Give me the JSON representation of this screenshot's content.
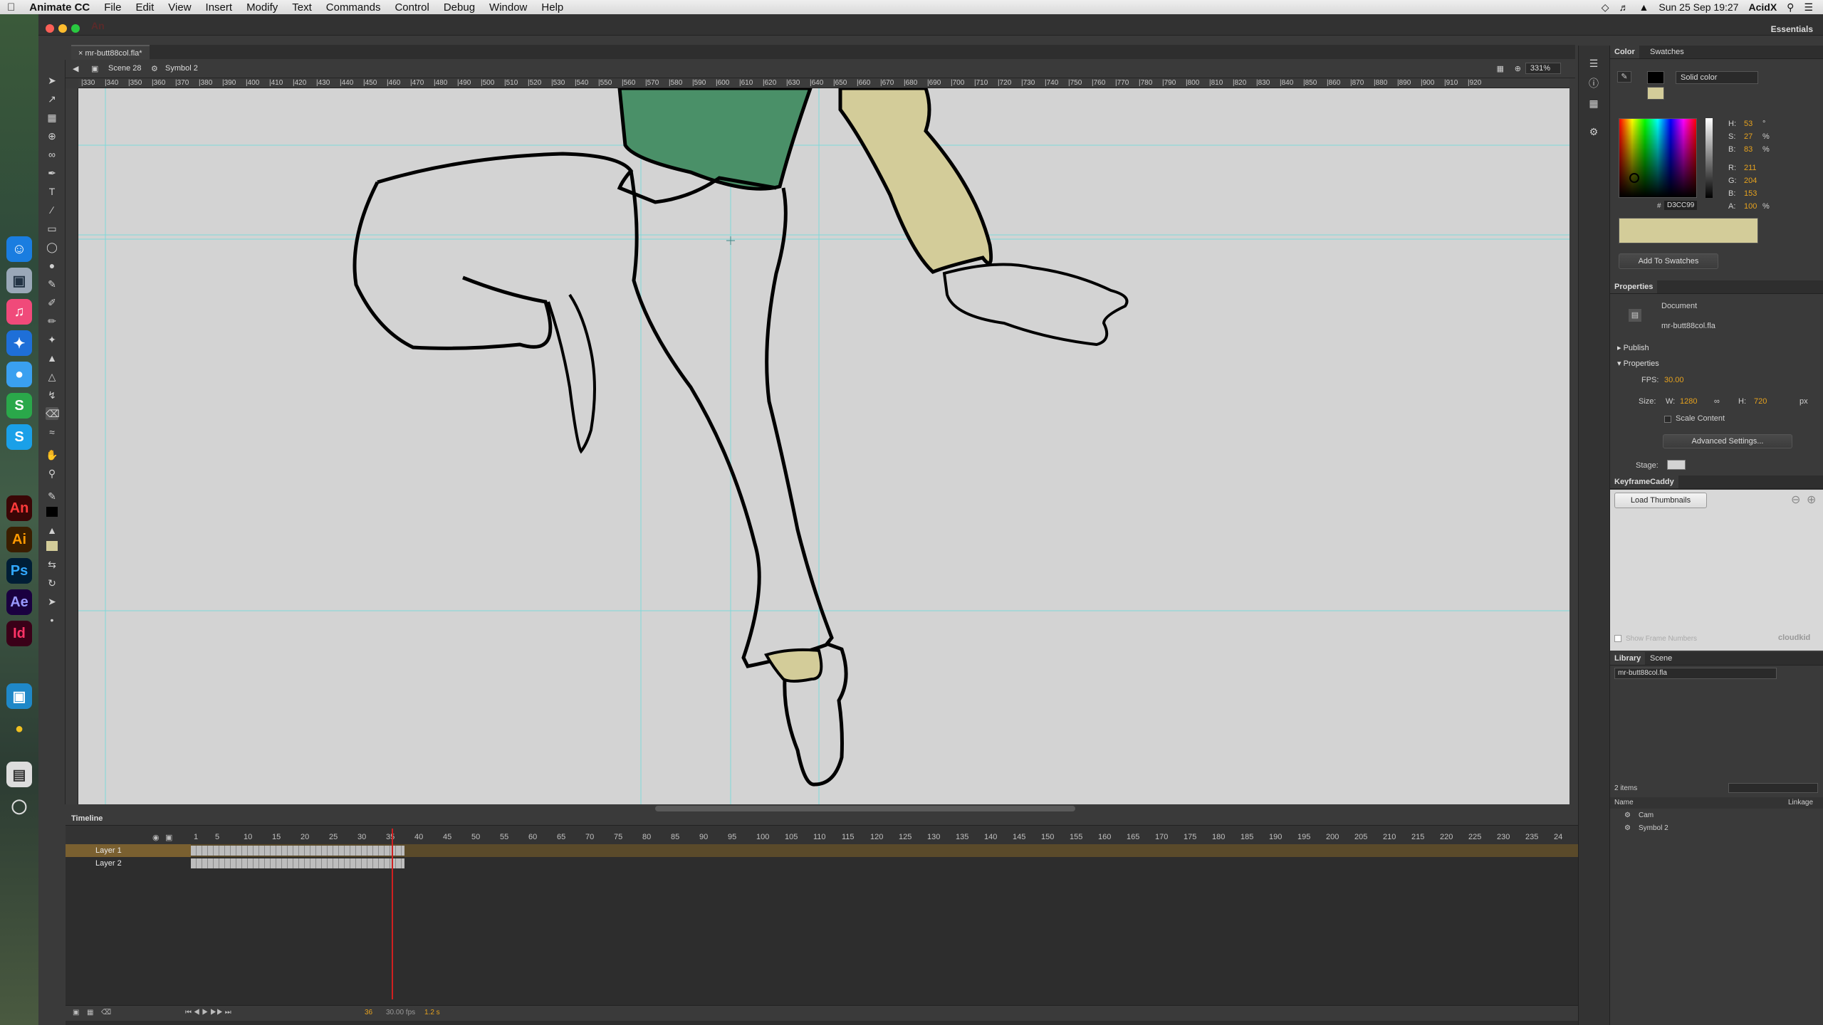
{
  "menubar": {
    "app_name": "Animate CC",
    "items": [
      "File",
      "Edit",
      "View",
      "Insert",
      "Modify",
      "Text",
      "Commands",
      "Control",
      "Debug",
      "Window",
      "Help"
    ],
    "datetime": "Sun 25 Sep 19:27",
    "user": "AcidX"
  },
  "window": {
    "logo": "An",
    "workspace": "Essentials"
  },
  "document": {
    "tab_title": "mr-butt88col.fla*",
    "scene": "Scene 28",
    "symbol": "Symbol 2",
    "zoom": "331%"
  },
  "ruler": {
    "ticks": [
      "330",
      "340",
      "350",
      "360",
      "370",
      "380",
      "390",
      "400",
      "410",
      "420",
      "430",
      "440",
      "450",
      "460",
      "470",
      "480",
      "490",
      "500",
      "510",
      "520",
      "530",
      "540",
      "550",
      "560",
      "570",
      "580",
      "590",
      "600",
      "610",
      "620",
      "630",
      "640",
      "650",
      "660",
      "670",
      "680",
      "690",
      "700",
      "710",
      "720",
      "730",
      "740",
      "750",
      "760",
      "770",
      "780",
      "790",
      "800",
      "810",
      "820",
      "830",
      "840",
      "850",
      "860",
      "870",
      "880",
      "890",
      "900",
      "910",
      "920"
    ]
  },
  "timeline": {
    "tab_label": "Timeline",
    "frame_numbers": [
      "1",
      "5",
      "10",
      "15",
      "20",
      "25",
      "30",
      "35",
      "40",
      "45",
      "50",
      "55",
      "60",
      "65",
      "70",
      "75",
      "80",
      "85",
      "90",
      "95",
      "100",
      "105",
      "110",
      "115",
      "120",
      "125",
      "130",
      "135",
      "140",
      "145",
      "150",
      "155",
      "160",
      "165",
      "170",
      "175",
      "180",
      "185",
      "190",
      "195",
      "200",
      "205",
      "210",
      "215",
      "220",
      "225",
      "230",
      "235",
      "24"
    ],
    "layers": [
      {
        "name": "Layer 1",
        "active": true
      },
      {
        "name": "Layer 2",
        "active": false
      }
    ],
    "current_frame": "36",
    "fps": "30.00 fps",
    "time": "1.2 s"
  },
  "color_panel": {
    "tabs": [
      "Color",
      "Swatches"
    ],
    "fill_type": "Solid color",
    "h": "53",
    "s": "27",
    "b": "83",
    "r": "211",
    "g": "204",
    "bl": "153",
    "alpha": "100",
    "hex": "D3CC99",
    "hex_prefix": "#",
    "add_swatch": "Add To Swatches",
    "swatch_color": "#d3cc99"
  },
  "properties_panel": {
    "title": "Properties",
    "doc_label": "Document",
    "doc_name": "mr-butt88col.fla",
    "publish": "Publish",
    "section": "Properties",
    "fps_label": "FPS:",
    "fps": "30.00",
    "size_label": "Size:",
    "w_label": "W:",
    "w": "1280",
    "h_label": "H:",
    "h": "720",
    "unit": "px",
    "scale_content": "Scale Content",
    "advanced": "Advanced Settings...",
    "stage_label": "Stage:"
  },
  "keyframe_caddy": {
    "title": "KeyframeCaddy",
    "load_button": "Load Thumbnails",
    "show_frames": "Show Frame Numbers",
    "brand": "cloudkid"
  },
  "library": {
    "tabs": [
      "Library",
      "Scene"
    ],
    "file": "mr-butt88col.fla",
    "count": "2 items",
    "col_name": "Name",
    "col_linkage": "Linkage",
    "items": [
      "Cam",
      "Symbol 2"
    ]
  },
  "colors": {
    "stage_bg": "#d3d3d3",
    "shirt_green": "#4a9068",
    "skin_tan": "#d3cc99",
    "accent_orange": "#e6a21e",
    "guide_cyan": "#7fd8d8"
  }
}
